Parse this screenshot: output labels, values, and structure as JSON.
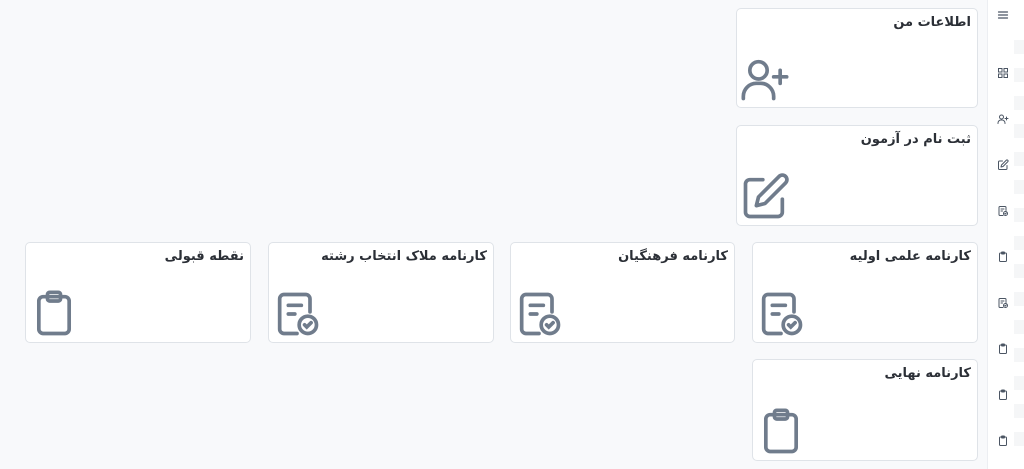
{
  "sidebar": {
    "items": [
      {
        "icon": "menu-icon"
      },
      {
        "icon": "dashboard-grid-icon"
      },
      {
        "icon": "user-plus-icon"
      },
      {
        "icon": "edit-icon"
      },
      {
        "icon": "report-card-icon"
      },
      {
        "icon": "clipboard-icon"
      },
      {
        "icon": "report-card-icon"
      },
      {
        "icon": "clipboard-icon"
      },
      {
        "icon": "clipboard-icon"
      },
      {
        "icon": "clipboard-icon"
      }
    ]
  },
  "cards": {
    "my_info": {
      "title": "اطلاعات من",
      "icon": "user-plus-icon"
    },
    "exam_registration": {
      "title": "ثبت نام در آزمون",
      "icon": "edit-icon"
    },
    "initial_scores": {
      "title": "کارنامه علمی اولیه",
      "icon": "report-card-icon"
    },
    "cultural_scores": {
      "title": "کارنامه فرهنگیان",
      "icon": "report-card-icon"
    },
    "major_selection_scores": {
      "title": "کارنامه ملاک انتخاب رشته",
      "icon": "report-card-icon"
    },
    "acceptance_point": {
      "title": "نقطه قبولی",
      "icon": "clipboard-icon"
    },
    "final_scores": {
      "title": "کارنامه نهایی",
      "icon": "clipboard-icon"
    }
  },
  "colors": {
    "icon": "#707c8c",
    "card_border": "#dfe3e8",
    "background": "#f8f9fb"
  }
}
